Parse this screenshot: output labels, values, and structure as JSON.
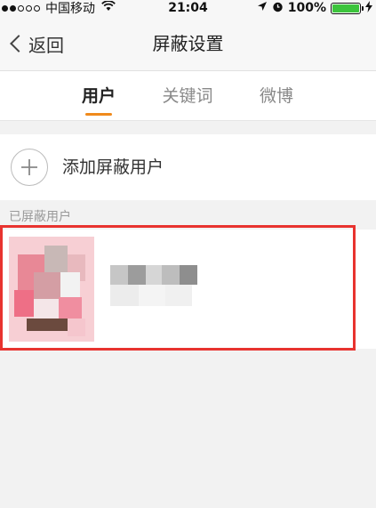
{
  "status_bar": {
    "carrier": "中国移动",
    "time": "21:04",
    "battery": "100%",
    "battery_level": 1.0
  },
  "nav": {
    "back_label": "返回",
    "title": "屏蔽设置"
  },
  "tabs": [
    {
      "label": "用户",
      "active": true
    },
    {
      "label": "关键词",
      "active": false
    },
    {
      "label": "微博",
      "active": false
    }
  ],
  "add_user": {
    "label": "添加屏蔽用户",
    "icon": "plus-icon"
  },
  "blocked_section": {
    "header": "已屏蔽用户"
  },
  "colors": {
    "accent": "#f08a1c",
    "highlight": "#e8332f",
    "battery": "#3cc43c"
  }
}
